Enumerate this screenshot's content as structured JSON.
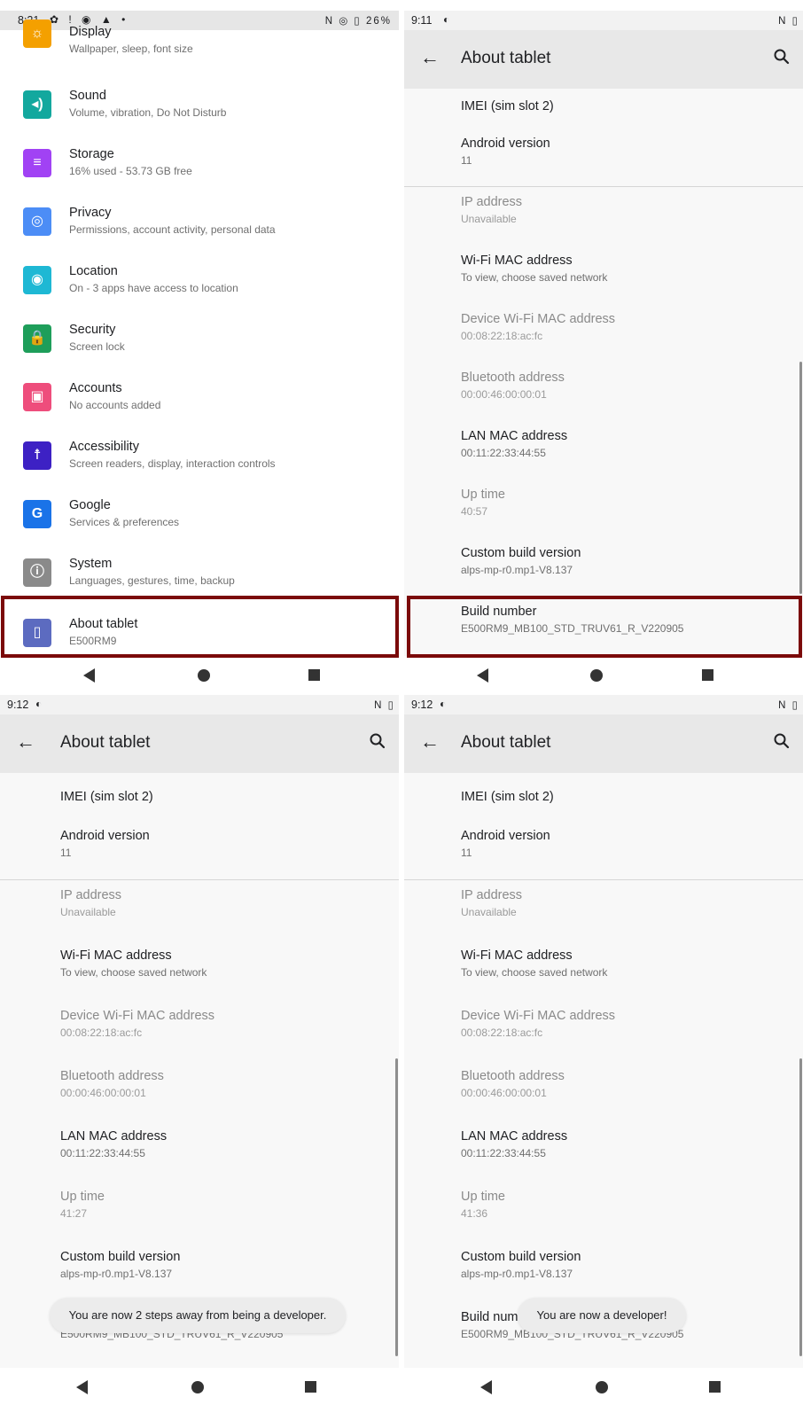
{
  "panel1": {
    "status": {
      "time": "8:21",
      "icons": "✿ ! ◉ ▲ •",
      "right_icons": "N ◎ ▯",
      "battery": "26%"
    },
    "items": [
      {
        "title": "Display",
        "subtitle": "Wallpaper, sleep, font size",
        "icon": "display-icon",
        "color": "#f4a000",
        "glyph": "☼"
      },
      {
        "title": "Sound",
        "subtitle": "Volume, vibration, Do Not Disturb",
        "icon": "sound-icon",
        "color": "#13a89e",
        "glyph": "◂)"
      },
      {
        "title": "Storage",
        "subtitle": "16% used - 53.73 GB free",
        "icon": "storage-icon",
        "color": "#a142f4",
        "glyph": "≡"
      },
      {
        "title": "Privacy",
        "subtitle": "Permissions, account activity, personal data",
        "icon": "privacy-icon",
        "color": "#4c8df6",
        "glyph": "◎"
      },
      {
        "title": "Location",
        "subtitle": "On - 3 apps have access to location",
        "icon": "location-icon",
        "color": "#1eb8d4",
        "glyph": "◉"
      },
      {
        "title": "Security",
        "subtitle": "Screen lock",
        "icon": "security-icon",
        "color": "#1e9e5a",
        "glyph": "🔒"
      },
      {
        "title": "Accounts",
        "subtitle": "No accounts added",
        "icon": "accounts-icon",
        "color": "#ee4d7c",
        "glyph": "▣"
      },
      {
        "title": "Accessibility",
        "subtitle": "Screen readers, display, interaction controls",
        "icon": "accessibility-icon",
        "color": "#3d21c4",
        "glyph": "☨"
      },
      {
        "title": "Google",
        "subtitle": "Services & preferences",
        "icon": "google-icon",
        "color": "#1a73e8",
        "glyph": "G"
      },
      {
        "title": "System",
        "subtitle": "Languages, gestures, time, backup",
        "icon": "system-icon",
        "color": "#8a8a8a",
        "glyph": "ⓘ"
      },
      {
        "title": "About tablet",
        "subtitle": "E500RM9",
        "icon": "about-tablet-icon",
        "color": "#5c6bc0",
        "glyph": "▯"
      }
    ]
  },
  "about": {
    "title": "About tablet",
    "imei": "IMEI (sim slot 2)",
    "android_version": {
      "title": "Android version",
      "value": "11"
    },
    "ip_address": {
      "title": "IP address",
      "value": "Unavailable"
    },
    "wifi_mac": {
      "title": "Wi-Fi MAC address",
      "value": "To view, choose saved network"
    },
    "device_wifi_mac": {
      "title": "Device Wi-Fi MAC address",
      "value": "00:08:22:18:ac:fc"
    },
    "bluetooth": {
      "title": "Bluetooth address",
      "value": "00:00:46:00:00:01"
    },
    "lan_mac": {
      "title": "LAN MAC address",
      "value": "00:11:22:33:44:55"
    },
    "uptime_title": "Up time",
    "custom_build": {
      "title": "Custom build version",
      "value": "alps-mp-r0.mp1-V8.137"
    },
    "build_number": {
      "title": "Build number",
      "value": "E500RM9_MB100_STD_TRUV61_R_V220905"
    }
  },
  "panel2": {
    "time": "9:11",
    "uptime": "40:57"
  },
  "panel3": {
    "time": "9:12",
    "uptime": "41:27",
    "toast": "You are now 2 steps away from being a developer."
  },
  "panel4": {
    "time": "9:12",
    "uptime": "41:36",
    "toast": "You are now a developer!"
  },
  "status_left_icon": "◐",
  "status_right_icons": "N ▯"
}
